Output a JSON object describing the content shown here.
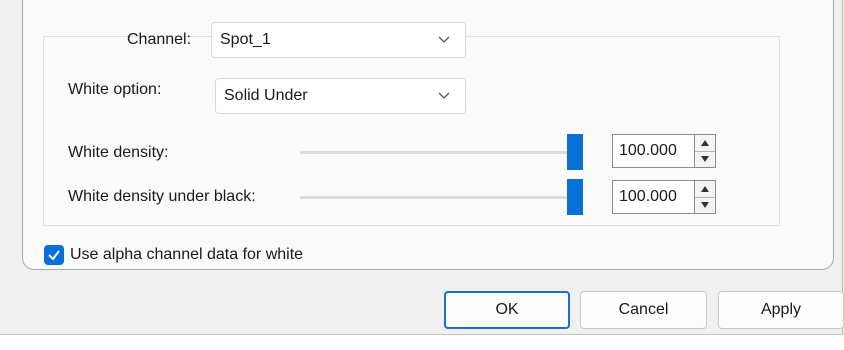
{
  "channel": {
    "label": "Channel:",
    "value": "Spot_1"
  },
  "white_option": {
    "label": "White option:",
    "value": "Solid Under"
  },
  "white_density": {
    "label": "White density:",
    "value": "100.000",
    "level": 1.0
  },
  "white_density_under_black": {
    "label": "White density under black:",
    "value": "100.000",
    "level": 1.0
  },
  "alpha_checkbox": {
    "label": "Use alpha channel data for white",
    "checked": true
  },
  "buttons": {
    "ok": "OK",
    "cancel": "Cancel",
    "apply": "Apply"
  },
  "colors": {
    "accent": "#0a6fd8"
  },
  "icons": {
    "dropdown": "chevron-down-icon",
    "spin_up": "arrow-up-icon",
    "spin_down": "arrow-down-icon",
    "check": "check-icon"
  }
}
